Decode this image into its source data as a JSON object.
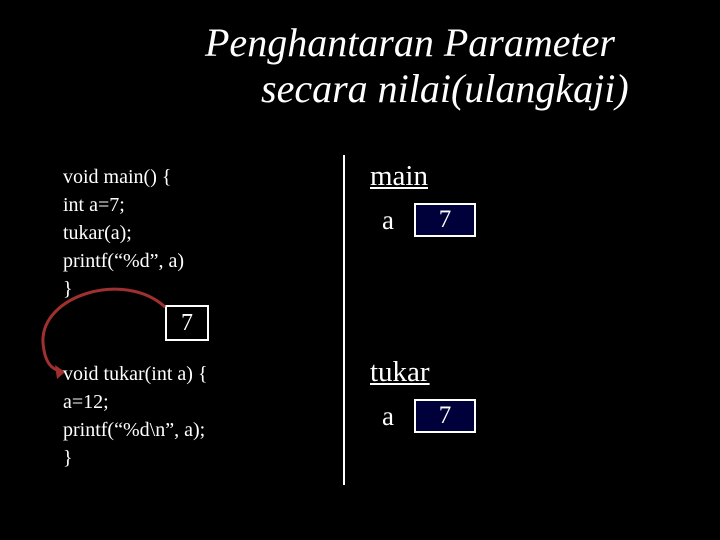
{
  "title": {
    "line1": "Penghantaran Parameter",
    "line2": "secara nilai(ulangkaji)"
  },
  "code": {
    "main": "void main() {\nint a=7;\ntukar(a);\nprintf(“%d”, a)\n}",
    "tukar": "void tukar(int a) {\na=12;\nprintf(“%d\\n”, a);\n}"
  },
  "stack": {
    "main": {
      "label": "main",
      "vars": [
        {
          "name": "a",
          "value": "7"
        }
      ]
    },
    "tukar": {
      "label": "tukar",
      "vars": [
        {
          "name": "a",
          "value": "7"
        }
      ]
    }
  },
  "passed_value": "7",
  "colors": {
    "background": "#000000",
    "text": "#ffffff",
    "box_fill": "#00003a"
  }
}
